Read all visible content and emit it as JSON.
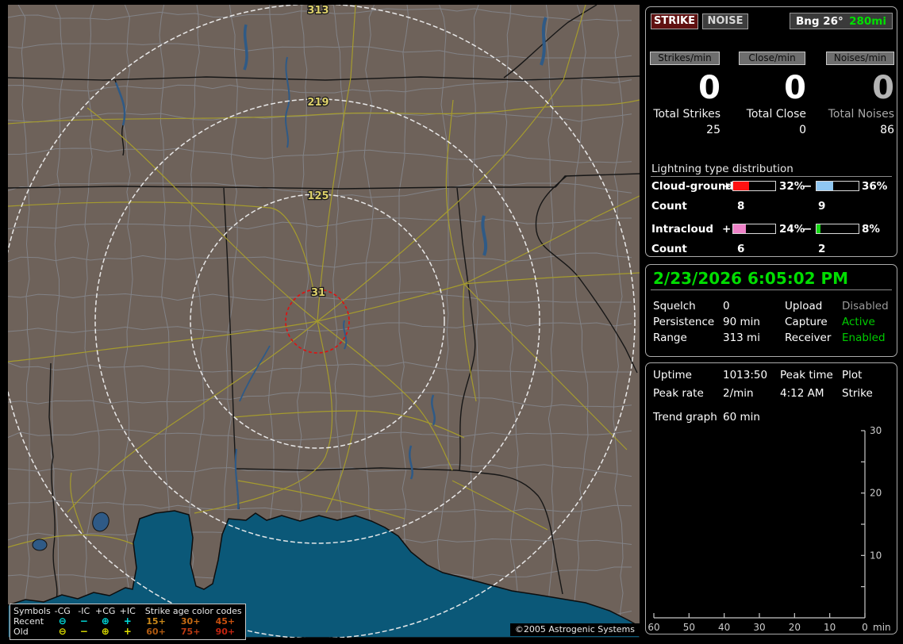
{
  "map": {
    "rings": [
      {
        "label": "313"
      },
      {
        "label": "219"
      },
      {
        "label": "125"
      },
      {
        "label": "31"
      }
    ],
    "legend": {
      "symbols_header": "Symbols",
      "type_headers": [
        "-CG",
        "-IC",
        "+CG",
        "+IC"
      ],
      "age_header": "Strike age color codes",
      "rows": [
        {
          "label": "Recent",
          "color": "#00e0e0",
          "symbols": [
            "⊖",
            "−",
            "⊕",
            "+"
          ],
          "ages": [
            {
              "t": "15+",
              "c": "#cc8a1a"
            },
            {
              "t": "30+",
              "c": "#c86c14"
            },
            {
              "t": "45+",
              "c": "#c8500f"
            }
          ]
        },
        {
          "label": "Old",
          "color": "#e0e000",
          "symbols": [
            "⊖",
            "−",
            "⊕",
            "+"
          ],
          "ages": [
            {
              "t": "60+",
              "c": "#b05a10"
            },
            {
              "t": "75+",
              "c": "#bc3a12"
            },
            {
              "t": "90+",
              "c": "#c42410"
            }
          ]
        }
      ]
    },
    "copyright": "©2005 Astrogenic Systems"
  },
  "panel": {
    "tabs": {
      "strike": "STRIKE",
      "noise": "NOISE"
    },
    "bearing": {
      "label": "Bng 26°",
      "range": "280mi",
      "range_color": "#00e000"
    },
    "counters": [
      {
        "rate_label": "Strikes/min",
        "rate_value": "0",
        "value_color": "#ffffff",
        "total_label": "Total Strikes",
        "total_label_color": "#f0f0f0",
        "total_value": "25"
      },
      {
        "rate_label": "Close/min",
        "rate_value": "0",
        "value_color": "#ffffff",
        "total_label": "Total Close",
        "total_label_color": "#f0f0f0",
        "total_value": "0"
      },
      {
        "rate_label": "Noises/min",
        "rate_value": "0",
        "value_color": "#b4b4b4",
        "total_label": "Total Noises",
        "total_label_color": "#a8a8a8",
        "total_value": "86"
      }
    ],
    "distribution": {
      "title": "Lightning type distribution",
      "count_label": "Count",
      "rows": [
        {
          "name": "Cloud-ground",
          "plus": {
            "sign": "+",
            "pct": 38,
            "pct_label": "32%",
            "count": "8",
            "color": "#ff1212"
          },
          "minus": {
            "sign": "−",
            "pct": 40,
            "pct_label": "36%",
            "count": "9",
            "color": "#8fc7f2"
          }
        },
        {
          "name": "Intracloud",
          "plus": {
            "sign": "+",
            "pct": 30,
            "pct_label": "24%",
            "count": "6",
            "color": "#ee82c8"
          },
          "minus": {
            "sign": "−",
            "pct": 9,
            "pct_label": "8%",
            "count": "2",
            "color": "#16d816"
          }
        }
      ]
    },
    "status": {
      "datetime": "2/23/2026 6:05:02 PM",
      "datetime_color": "#00dd00",
      "rows": [
        {
          "l1": "Squelch",
          "v1": "0",
          "l2": "Upload",
          "v2": "Disabled",
          "v2_color": "#9a9a9a"
        },
        {
          "l1": "Persistence",
          "v1": "90 min",
          "l2": "Capture",
          "v2": "Active",
          "v2_color": "#00cc00"
        },
        {
          "l1": "Range",
          "v1": "313 mi",
          "l2": "Receiver",
          "v2": "Enabled",
          "v2_color": "#00cc00"
        }
      ]
    },
    "info": {
      "rows": [
        {
          "c1": "Uptime",
          "c2": "1013:50",
          "c3": "Peak time",
          "c4": "Plot"
        },
        {
          "c1": "Peak rate",
          "c2": "2/min",
          "c3": "4:12 AM",
          "c4": "Strike"
        }
      ]
    },
    "trend": {
      "label": "Trend graph",
      "window": "60 min",
      "x_ticks": [
        60,
        50,
        40,
        30,
        20,
        10,
        0
      ],
      "x_unit": "min",
      "y_max": 30,
      "y_minor_step": 5,
      "y_label_step": 10,
      "axis_color": "#c8c8c8"
    }
  }
}
